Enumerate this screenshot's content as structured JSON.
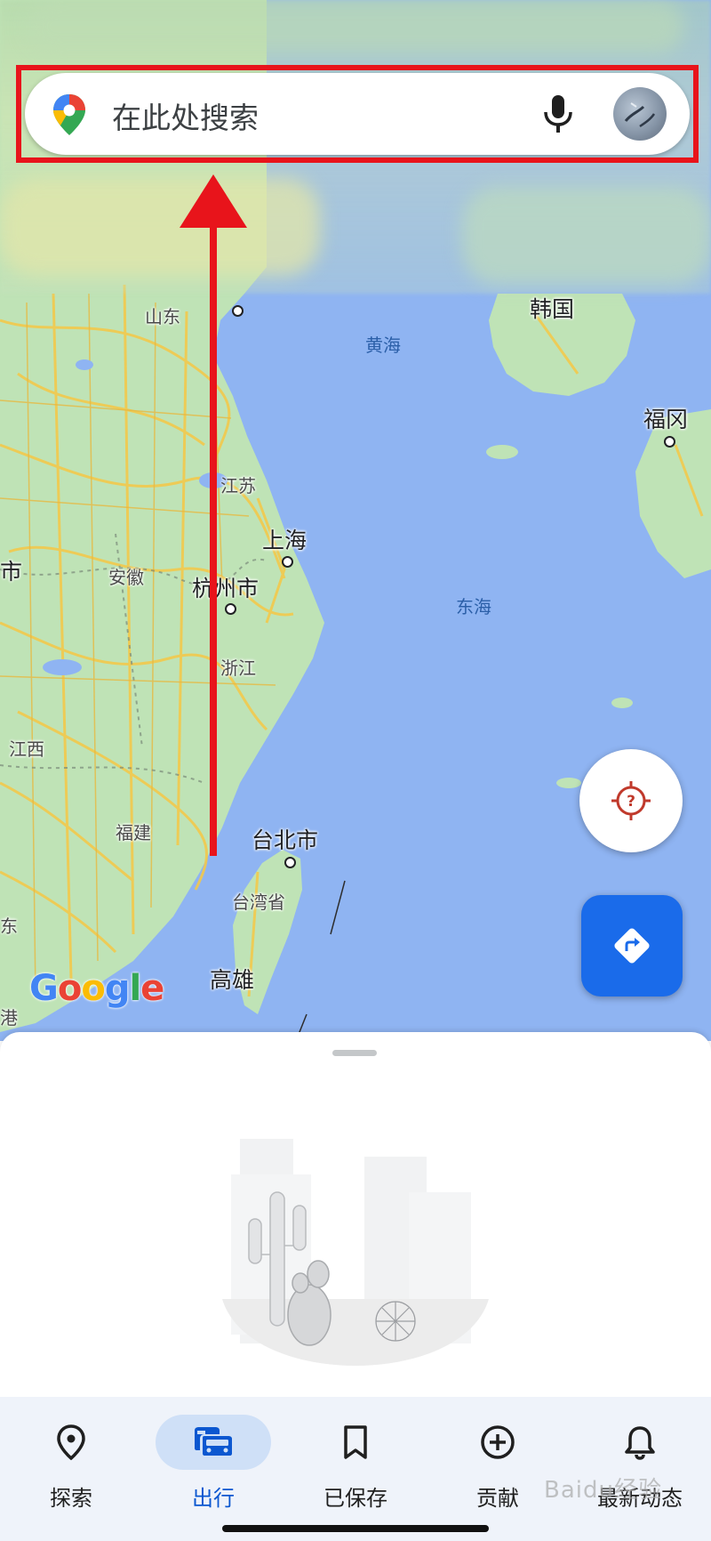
{
  "search": {
    "placeholder": "在此处搜索"
  },
  "map": {
    "labels": {
      "shandong": "山东",
      "yellow_sea": "黄海",
      "korea": "韩国",
      "fukuoka": "福冈",
      "jiangsu": "江苏",
      "shanghai": "上海",
      "anhui": "安徽",
      "hangzhou": "杭州市",
      "east_sea": "东海",
      "zhejiang": "浙江",
      "jiangxi": "江西",
      "fujian": "福建",
      "taipei": "台北市",
      "taiwan": "台湾省",
      "kaohsiung": "高雄",
      "edge_shi": "市",
      "edge_dong": "东",
      "edge_gang": "港"
    },
    "logo": [
      "G",
      "o",
      "o",
      "g",
      "l",
      "e"
    ],
    "colors": {
      "water": "#8fb4f2",
      "land": "#bfe3b6",
      "road": "#f2c94c"
    }
  },
  "fabs": {
    "location_icon": "crosshair-question-icon",
    "directions_icon": "directions-icon"
  },
  "nav": {
    "items": [
      {
        "label": "探索",
        "icon": "location-pin-icon"
      },
      {
        "label": "出行",
        "icon": "commute-icon"
      },
      {
        "label": "已保存",
        "icon": "bookmark-icon"
      },
      {
        "label": "贡献",
        "icon": "add-circle-icon"
      },
      {
        "label": "最新动态",
        "icon": "bell-icon"
      }
    ],
    "active_index": 1
  },
  "watermark": "Baidu经验",
  "annotation": {
    "highlight_color": "#e8141b"
  }
}
